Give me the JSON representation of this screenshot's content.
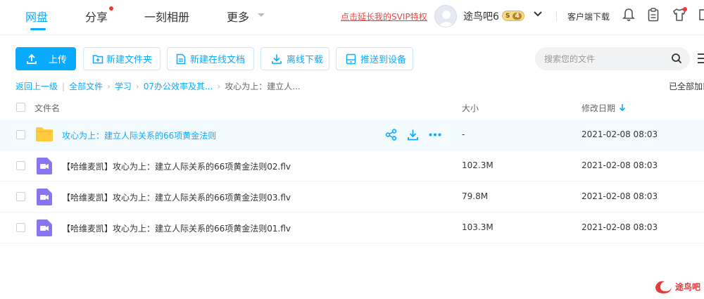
{
  "nav": {
    "items": [
      {
        "label": "网盘",
        "active": true
      },
      {
        "label": "分享",
        "badge_dot": true
      },
      {
        "label": "一刻相册"
      },
      {
        "label": "更多"
      }
    ],
    "svip_link": "点击延长我的SVIP特权",
    "username": "途鸟吧6",
    "level_badge": {
      "left": "S",
      "level": "4"
    },
    "client_download": "客户端下载"
  },
  "toolbar": {
    "upload": "上传",
    "new_folder": "新建文件夹",
    "new_doc": "新建在线文档",
    "offline_download": "离线下载",
    "push_to_device": "推送到设备",
    "search_placeholder": "搜索您的文件"
  },
  "breadcrumb": {
    "items": [
      "返回上一级",
      "全部文件",
      "学习",
      "07办公效率及其...",
      "攻心为上：建立人..."
    ],
    "loaded_text": "已全部加载"
  },
  "table": {
    "headers": {
      "name": "文件名",
      "size": "大小",
      "modified": "修改日期"
    },
    "rows": [
      {
        "type": "folder",
        "name": "攻心为上：建立人际关系的66项黄金法则",
        "size": "-",
        "date": "2021-02-08 08:03"
      },
      {
        "type": "video",
        "name": "【哈维麦凯】攻心为上：建立人际关系的66项黄金法则02.flv",
        "size": "102.3M",
        "date": "2021-02-08 08:03"
      },
      {
        "type": "video",
        "name": "【哈维麦凯】攻心为上：建立人际关系的66项黄金法则03.flv",
        "size": "79.8M",
        "date": "2021-02-08 08:03"
      },
      {
        "type": "video",
        "name": "【哈维麦凯】攻心为上：建立人际关系的66项黄金法则01.flv",
        "size": "103.3M",
        "date": "2021-02-08 08:03"
      }
    ]
  },
  "watermark": {
    "text": "途鸟吧"
  },
  "colors": {
    "accent": "#09aaff",
    "svip": "#f2433a",
    "folder": "#ffc940",
    "video": "#8b74f0"
  }
}
